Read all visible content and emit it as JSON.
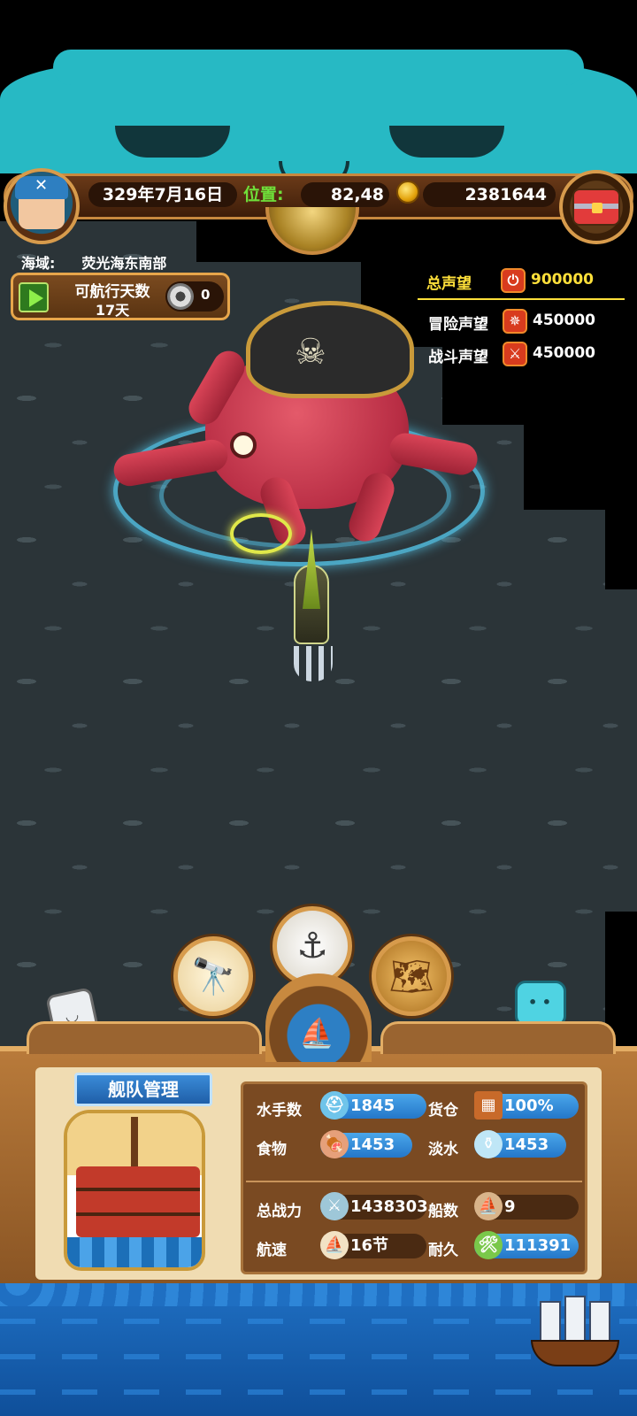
{
  "header": {
    "date": "329年7月16日",
    "position_label": "位置:",
    "position_value": "82,48",
    "gold": "2381644",
    "icons": {
      "avatar": "pirate-avatar-icon",
      "coin": "gold-coin-icon",
      "treasure": "treasure-chest-icon",
      "compass": "compass-icon"
    }
  },
  "sea_area": {
    "label": "海域:",
    "name": "荧光海东南部"
  },
  "voyage": {
    "title": "可航行天数",
    "days": "17天",
    "token_count": "0"
  },
  "reputation": {
    "total": {
      "label": "总声望",
      "value": "900000"
    },
    "adventure": {
      "label": "冒险声望",
      "value": "450000"
    },
    "battle": {
      "label": "战斗声望",
      "value": "450000"
    }
  },
  "actions": [
    {
      "name": "spyglass",
      "icon": "spyglass-icon"
    },
    {
      "name": "anchor",
      "icon": "anchor-icon"
    },
    {
      "name": "world-map",
      "icon": "world-map-icon"
    }
  ],
  "fleet": {
    "title": "舰队管理",
    "stats": {
      "sailors": {
        "label": "水手数",
        "value": "1845"
      },
      "cargo": {
        "label": "货仓",
        "value": "100%"
      },
      "food": {
        "label": "食物",
        "value": "1453"
      },
      "water": {
        "label": "淡水",
        "value": "1453"
      },
      "power": {
        "label": "总战力",
        "value": "1438303"
      },
      "ships": {
        "label": "船数",
        "value": "9"
      },
      "speed": {
        "label": "航速",
        "value": "16节"
      },
      "durability": {
        "label": "耐久",
        "value": "111391"
      }
    }
  },
  "colors": {
    "reputation_total": "#ffe03a",
    "position_label": "#6fe03a",
    "cat_banner": "#27b9c4",
    "stat_pill_blue": "#2f88d8",
    "panel_wood": "#8a5524",
    "sea": "#2b3438"
  }
}
